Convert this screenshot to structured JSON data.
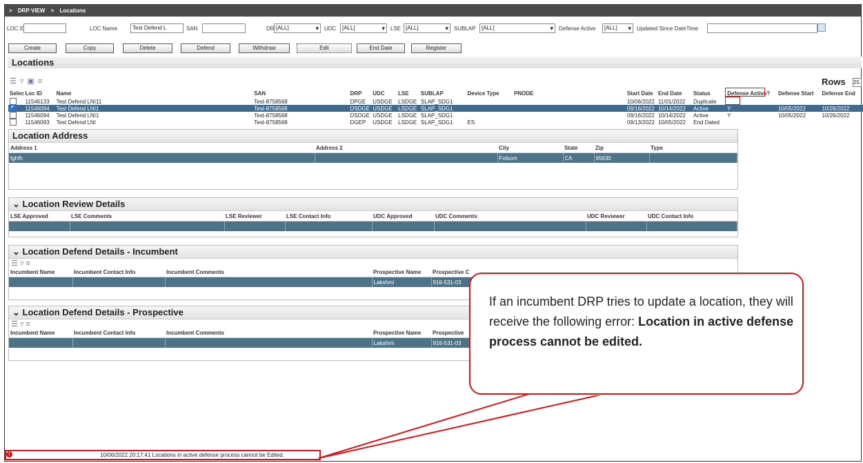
{
  "breadcrumb": {
    "sep": ">",
    "items": [
      "DRP VIEW",
      "Locations"
    ]
  },
  "filters": {
    "loc_id_label": "LOC ID",
    "loc_id_value": "",
    "loc_name_label": "LOC Name",
    "loc_name_value": "Test Defend L",
    "san_label": "SAN",
    "san_value": "",
    "drp_label": "DRP",
    "drp_value": "[ALL]",
    "udc_label": "UDC",
    "udc_value": "[ALL]",
    "lse_label": "LSE",
    "lse_value": "[ALL]",
    "sublap_label": "SUBLAP",
    "sublap_value": "[ALL]",
    "defense_label": "Defense Active",
    "defense_value": "[ALL]",
    "updated_label": "Updated Since DateTime",
    "updated_value": ""
  },
  "toolbar": [
    "Create",
    "Copy",
    "Delete",
    "Defend",
    "Withdraw",
    "Edit",
    "End Date",
    "Register"
  ],
  "locations": {
    "title": "Locations",
    "rows_label": "Rows",
    "rows_value": "25",
    "columns": [
      "Select",
      "Loc ID",
      "Name",
      "SAN",
      "DRP",
      "UDC",
      "LSE",
      "SUBLAP",
      "Device Type",
      "PNODE",
      "Start Date",
      "End Date",
      "Status",
      "Defense Active?",
      "Defense Start",
      "Defense End"
    ],
    "rows": [
      {
        "checked": false,
        "cells": [
          "11546133",
          "Test Defend LNI11",
          "Test-8758568",
          "DPGE",
          "USDGE",
          "LSDGE",
          "SLAP_SDG1",
          "",
          "",
          "10/06/2022",
          "11/01/2022",
          "Duplicate",
          "",
          "",
          ""
        ]
      },
      {
        "checked": true,
        "cells": [
          "11546094",
          "Test Defend LNI1",
          "Test-8758568",
          "DSDGE",
          "USDGE",
          "LSDGE",
          "SLAP_SDG1",
          "",
          "",
          "09/16/2022",
          "10/14/2022",
          "Active",
          "Y",
          "10/05/2022",
          "10/26/2022"
        ]
      },
      {
        "checked": false,
        "cells": [
          "11546094",
          "Test Defend LNI1",
          "Test-8758568",
          "DSDGE",
          "USDGE",
          "LSDGE",
          "SLAP_SDG1",
          "",
          "",
          "09/16/2022",
          "10/14/2022",
          "Active",
          "Y",
          "10/05/2022",
          "10/26/2022"
        ]
      },
      {
        "checked": false,
        "cells": [
          "11546093",
          "Test Defend LNI",
          "Test-8758568",
          "DGEP",
          "USDGE",
          "LSDGE",
          "SLAP_SDG1",
          "ES",
          "",
          "09/13/2022",
          "10/05/2022",
          "End Dated",
          "",
          "",
          ""
        ]
      }
    ]
  },
  "address": {
    "title": "Location Address",
    "columns": [
      "Address 1",
      "Address 2",
      "City",
      "State",
      "Zip",
      "Type"
    ],
    "row": [
      "fghfh",
      "",
      "Folsom",
      "CA",
      "95630",
      ""
    ]
  },
  "review": {
    "title": "Location Review Details",
    "columns": [
      "LSE Approved",
      "LSE Comments",
      "LSE Reviewer",
      "LSE Contact Info",
      "UDC Approved",
      "UDC Comments",
      "UDC Reviewer",
      "UDC Contact Info"
    ]
  },
  "incumbent": {
    "title": "Location Defend Details - Incumbent",
    "columns": [
      "Incumbent Name",
      "Incumbent Contact Info",
      "Incumbent Comments",
      "Prospective Name",
      "Prospective C"
    ],
    "row": [
      "",
      "",
      "",
      "Lakshmi",
      "916-531-03"
    ]
  },
  "prospective": {
    "title": "Location Defend Details - Prospective",
    "columns": [
      "Incumbent Name",
      "Incumbent Contact Info",
      "Incumbent Comments",
      "Prospective Name",
      "Prospective"
    ],
    "row": [
      "",
      "",
      "",
      "Lakshmi",
      "916-531-03"
    ]
  },
  "callout": {
    "text": "If an incumbent DRP tries to update a location, they will receive the following error:",
    "bold": "Location in active defense process cannot be edited."
  },
  "status": {
    "icon": "!",
    "message": "10/06/2022 20:17:41 Locations in active defense process cannot be Edited."
  },
  "colors": {
    "selected_row": "#3d6a8e",
    "data_row": "#4d7389",
    "callout_border": "#dd1111"
  }
}
